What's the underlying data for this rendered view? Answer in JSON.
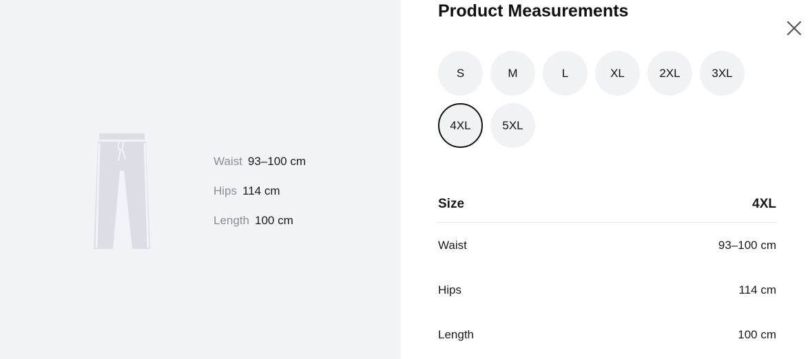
{
  "title": "Product Measurements",
  "accent": "#111111",
  "panel_bg": "#f2f3f7",
  "sizes": [
    {
      "label": "S",
      "selected": false
    },
    {
      "label": "M",
      "selected": false
    },
    {
      "label": "L",
      "selected": false
    },
    {
      "label": "XL",
      "selected": false
    },
    {
      "label": "2XL",
      "selected": false
    },
    {
      "label": "3XL",
      "selected": false
    },
    {
      "label": "4XL",
      "selected": true
    },
    {
      "label": "5XL",
      "selected": false
    }
  ],
  "illustration": {
    "icon": "pants-icon",
    "measures": [
      {
        "label": "Waist",
        "value": "93–100 cm"
      },
      {
        "label": "Hips",
        "value": "114 cm"
      },
      {
        "label": "Length",
        "value": "100 cm"
      }
    ]
  },
  "table": {
    "header": {
      "label": "Size",
      "value": "4XL"
    },
    "rows": [
      {
        "label": "Waist",
        "value": "93–100 cm"
      },
      {
        "label": "Hips",
        "value": "114 cm"
      },
      {
        "label": "Length",
        "value": "100 cm"
      }
    ]
  }
}
